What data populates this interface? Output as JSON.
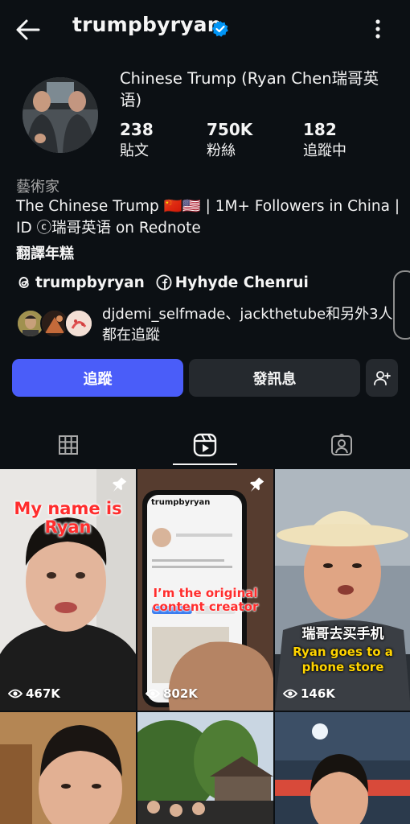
{
  "header": {
    "username": "trumpbyryan"
  },
  "profile": {
    "display_name": "Chinese Trump (Ryan Chen瑞哥英语)",
    "stats": [
      {
        "value": "238",
        "label": "貼文"
      },
      {
        "value": "750K",
        "label": "粉絲"
      },
      {
        "value": "182",
        "label": "追蹤中"
      }
    ],
    "category": "藝術家",
    "bio": "The Chinese Trump 🇨🇳🇺🇸 | 1M+ Followers in China | ID ⓒ瑞哥英语 on Rednote",
    "translate": "翻譯年糕",
    "links": [
      {
        "icon": "threads-icon",
        "text": "trumpbyryan"
      },
      {
        "icon": "facebook-icon",
        "text": "Hyhyde Chenrui"
      }
    ],
    "followed_by": "djdemi_selfmade、jackthetube和另外3人都在追蹤"
  },
  "actions": {
    "follow": "追蹤",
    "message": "發訊息"
  },
  "tabs": [
    {
      "name": "grid-icon"
    },
    {
      "name": "reels-icon",
      "active": true
    },
    {
      "name": "tagged-icon"
    }
  ],
  "posts": [
    {
      "caption": "My name is Ryan",
      "views": "467K",
      "pinned": true
    },
    {
      "caption": "I’m the original content creator",
      "views": "802K",
      "pinned": true,
      "screen_name": "trumpbyryan"
    },
    {
      "caption_cn": "瑞哥去买手机",
      "caption_en": "Ryan goes to a phone store",
      "views": "146K",
      "pinned": false
    },
    {
      "views": ""
    },
    {
      "views": ""
    },
    {
      "views": ""
    }
  ],
  "colors": {
    "background": "#0c1014",
    "follow_button": "#4a5df9",
    "secondary_button": "#25292e",
    "verified": "#0095f6",
    "caption_red": "#ff2d2d",
    "caption_yellow": "#ffd400"
  }
}
